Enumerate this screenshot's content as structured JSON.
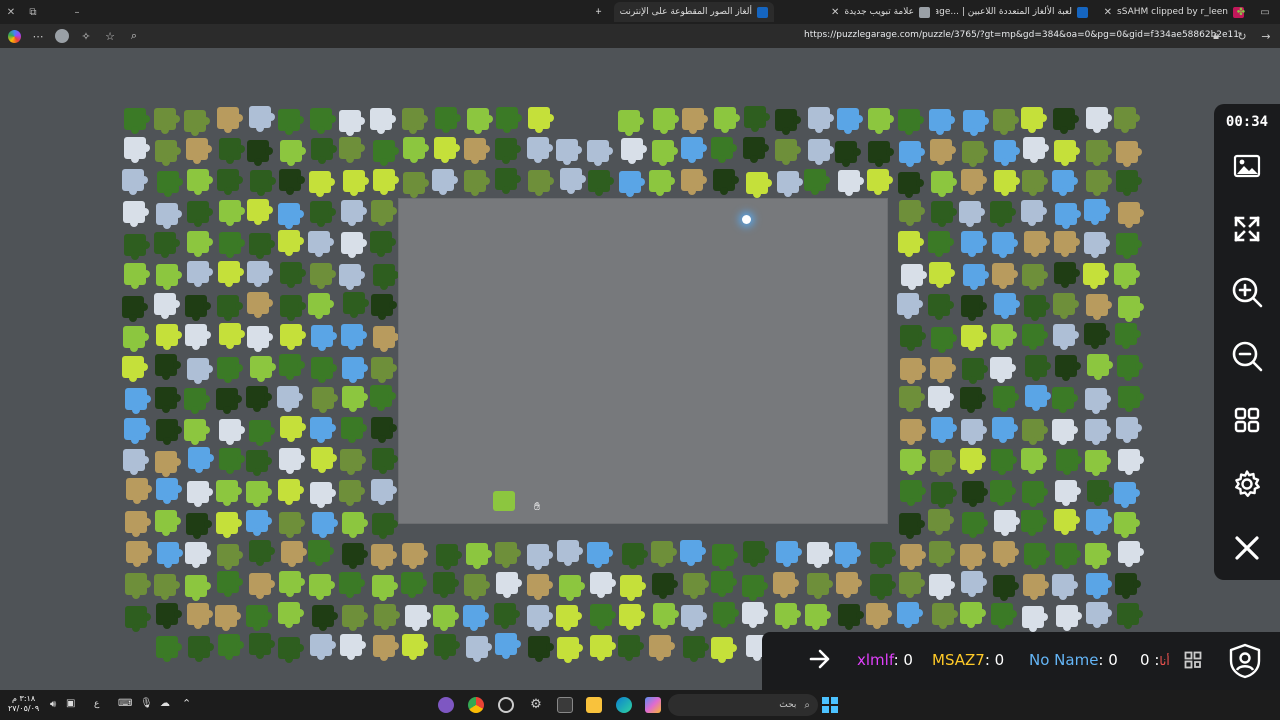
{
  "browser": {
    "tabs": [
      {
        "title": "sSAHM clipped by r_leen",
        "favicon_color": "#c2185b"
      },
      {
        "title": "لعبة الألغاز المتعددة اللاعبين | ...age",
        "favicon_color": "#1565c0"
      },
      {
        "title": "علامة تبويب جديدة",
        "favicon_color": "#9aa0a6"
      },
      {
        "title": "ألغاز الصور المقطوعة على الإنترنت",
        "favicon_color": "#1565c0"
      }
    ],
    "new_tab_label": "+",
    "url": "https://puzzlegarage.com/puzzle/3765/?gt=mp&gd=384&oa=0&pg=0&gid=f334ae58862b2e11"
  },
  "panel": {
    "timer": "00:34",
    "buttons": [
      "image-preview",
      "fullscreen",
      "zoom-in",
      "zoom-out",
      "sort-pieces",
      "settings",
      "close"
    ]
  },
  "scoreboard": {
    "players": [
      {
        "name": "xlmlf",
        "score": "0",
        "color": "#e040fb"
      },
      {
        "name": "MSAZ7",
        "score": "0",
        "color": "#ffca28"
      },
      {
        "name": "No Name",
        "score": "0",
        "color": "#64b5f6"
      },
      {
        "name": "أنا",
        "score": "0",
        "color": "#ef5350"
      }
    ]
  },
  "taskbar": {
    "search_placeholder": "بحث",
    "clock_time": "٣:١٨ م",
    "clock_date": "٢٧/٠٥/٠٩",
    "lang": "ع"
  },
  "colors": {
    "stage": "#4f5357",
    "board": "#77797c",
    "piece_palette": [
      "#2e5e1f",
      "#3b7a26",
      "#8cc63f",
      "#c5e03a",
      "#aebfd6",
      "#6e8f3a",
      "#1f3d14",
      "#b89b5e",
      "#5aa5e6",
      "#d8dfe8"
    ]
  }
}
